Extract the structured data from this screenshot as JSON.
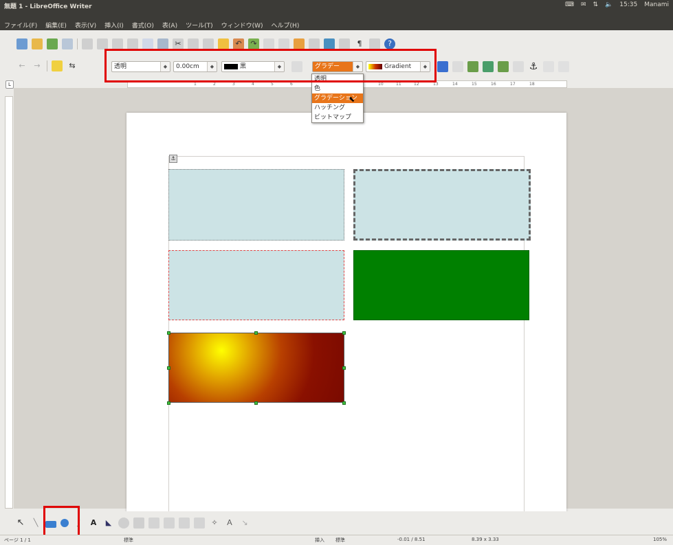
{
  "window": {
    "title": "無題 1 - LibreOffice Writer",
    "tray": {
      "clock": "15:35",
      "user": "Manami"
    }
  },
  "menu": {
    "items": [
      "ファイル(F)",
      "編集(E)",
      "表示(V)",
      "挿入(I)",
      "書式(O)",
      "表(A)",
      "ツール(T)",
      "ウィンドウ(W)",
      "ヘルプ(H)"
    ]
  },
  "drawing_props": {
    "line_style": "透明",
    "line_width": "0.00cm",
    "line_color": "黒",
    "area_style": "グラデーション",
    "area_style_short": "グラデー",
    "area_fill": "Gradient",
    "area_fill_color": "#cc2200"
  },
  "area_style_dropdown": {
    "options": [
      "透明",
      "色",
      "グラデーション",
      "ハッチング",
      "ビットマップ"
    ],
    "selected_index": 2
  },
  "shapes": [
    {
      "fill": "#cce3e5",
      "border": "dotted"
    },
    {
      "fill": "#cce3e5",
      "border": "dash-dot"
    },
    {
      "fill": "#cce3e5",
      "border": "dashed-red"
    },
    {
      "fill": "#008000",
      "border": "solid"
    },
    {
      "fill": "radial-gradient yellow to dark red",
      "border": "solid",
      "selected": true
    }
  ],
  "ruler": {
    "ticks": [
      "1",
      "2",
      "3",
      "4",
      "5",
      "6",
      "10",
      "11",
      "12",
      "13",
      "14",
      "15",
      "16",
      "17",
      "18"
    ]
  },
  "status": {
    "page": "ページ 1 / 1",
    "style": "標準",
    "insert_mode": "挿入",
    "select_mode": "標準",
    "position": "-0.01 / 8.51",
    "size": "8.39 x 3.33",
    "zoom": "105%"
  },
  "highlights": {
    "color": "#e00000"
  }
}
